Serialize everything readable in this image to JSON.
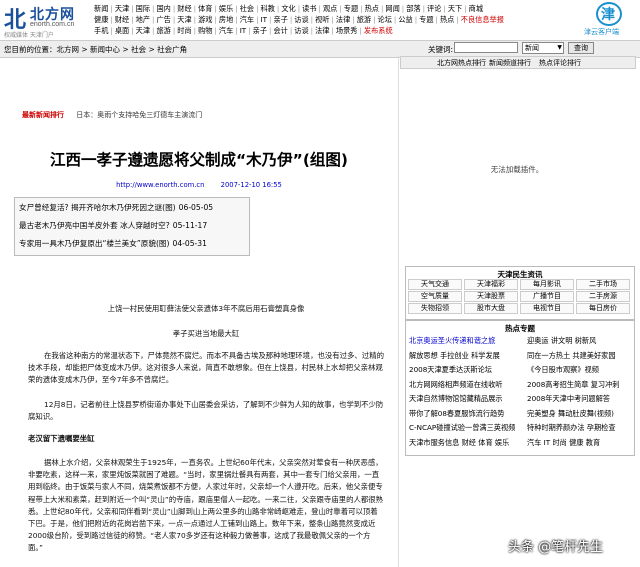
{
  "logo": {
    "big": "北",
    "wordmark": "北方网",
    "url": "enorth.com.cn",
    "slogan": "权威媒体 天津门户"
  },
  "nav": {
    "row1": [
      "新闻",
      "天津",
      "国际",
      "国内",
      "财经",
      "体育",
      "娱乐",
      "社会",
      "科教",
      "文化",
      "读书",
      "观点",
      "专题",
      "热点",
      "网闻",
      "部落",
      "评论",
      "天下",
      "商城"
    ],
    "row2": [
      "健康",
      "财经",
      "地产",
      "广告",
      "天津",
      "游戏",
      "房地",
      "汽车",
      "IT",
      "亲子",
      "访谈",
      "视听",
      "法律",
      "旅游",
      "论坛",
      "公益",
      "专题",
      "热点",
      "不良信息举报"
    ],
    "row3": [
      "手机",
      "桌面",
      "天津",
      "旅游",
      "时尚",
      "购物",
      "汽车",
      "IT",
      "亲子",
      "会计",
      "访谈",
      "法律",
      "场景秀",
      "发布系统"
    ]
  },
  "jin_logo": {
    "glyph": "津",
    "caption": "津云客户端"
  },
  "crumb": {
    "text": "您目前的位置：北方网 > 新闻中心 > 社会 > 社会广角"
  },
  "search": {
    "label": "关键词:",
    "value": "",
    "select": "新闻",
    "button": "查询"
  },
  "sidebar_tabs": [
    "北方网热点排行",
    "新闻频道排行",
    "热点评论排行"
  ],
  "ticker": {
    "label": "最新新闻排行",
    "text": "日本：奥雨个支持哈免三灯德车主演流门"
  },
  "article": {
    "title": "江西一孝子遵遗愿将父制成“木乃伊”(组图)",
    "source": "http://www.enorth.com.cn",
    "date": "2007-12-10 16:55",
    "related": [
      {
        "text": "女尸曾经复活? 揭开齐哈尔木乃伊死因之谜(图)",
        "date": "06-05-05"
      },
      {
        "text": "最古老木乃伊亮中国羊皮外套 冰人穿越时空?",
        "date": "05-11-17"
      },
      {
        "text": "专家用一具木乃伊复原出“楼兰美女”原貌(图)",
        "date": "04-05-31"
      }
    ],
    "subtitle": "上饶一村民使用耵藓法使父亲遗体3年不腐后用石膏塑真身像",
    "section1": "孝子买进当地最大缸",
    "para1": "在我省这种南方的常温状态下，尸体竟然不腐烂。而本不具备古埃及那种地理环境，也没有过多、过精的技术手段，却能把尸体变成木乃伊。这对很多人来说，简直不敢想象。但在上饶县，村民林上水却把父亲林观荣的遗体变成木乃伊，至今7年多不曾腐烂。",
    "para2": "12月8日，记者前往上饶县罗桥街道办事处下山居委会采访，了解到不少鲜为人知的故事，也学到不少防腐知识。",
    "section2": "老汉留下遗嘱要坐缸",
    "para3": "据林上水介绍，父亲林观荣生于1925年，一直务农。上世纪60年代末，父亲突然对荤食有一种厌恶感，非要吃素，这样一来，家里炖饭菜就困了难题。“当时，家里锅灶餐具有两套，其中一套专门给父亲用，一直用到临终。由于饭菜与家人不同，烧菜煮饭都不方便，人家过年时，父亲却一个人遵开吃。后来，他父亲便专程带上大米和素菜，赶到附近一个叫“灵山”的寺庙，跟庙里僧人一起吃。一来二往，父亲跟寺庙里的人都很熟悉。上世纪80年代，父亲和同伴看到“灵山”山脚到山上两公里多的山路非常崎岖难走，登山时靠着可以顶着下巴。于是，他们把附近的花岗岩凿下来，一点一点通过人工铺到山路上。数年下来，整条山路竟然变成近2000级台阶，受到路过信徒的称赞。“老人家70多岁还有这种毅力做善事，这成了我最敬佩父亲的一个方面。”"
  },
  "noplugin": "无法加载插件。",
  "services": {
    "title": "天津民生资讯",
    "cells": [
      "天气交通",
      "天津福彩",
      "每月影讯",
      "二手市场",
      "空气质量",
      "天津股票",
      "广播节目",
      "二手房源",
      "失物招领",
      "股市大盘",
      "电视节目",
      "每日房价"
    ]
  },
  "hot": {
    "title": "热点专题",
    "lines": [
      [
        "北京奥运圣火传递和谐之旅",
        "迎奥运 讲文明 树新风"
      ],
      [
        "解放思想 手拉创业 科学发展",
        "同在一方热土 共建美好家园"
      ],
      [
        "2008天津夏季达沃斯论坛",
        "《今日股市观察》视频"
      ],
      [
        "北方网网络相声频道在线收听",
        "2008高考招生简章 复习冲刺"
      ],
      [
        "天津自然博物馆馆藏精品展示",
        "2008年天津中考问题解答"
      ],
      [
        "带你了解08春夏服饰流行趋势",
        "完美塑身 舞动肚皮舞(视频)"
      ],
      [
        "C-NCAP碰撞试验一曾满三英视频",
        "特种时期养颜办法 孕期检查"
      ],
      [
        "天津市服务信息 财经 体育 娱乐",
        "汽车 IT 时尚 健康 教育"
      ]
    ]
  },
  "watermark": "头条 @笔杆先生"
}
